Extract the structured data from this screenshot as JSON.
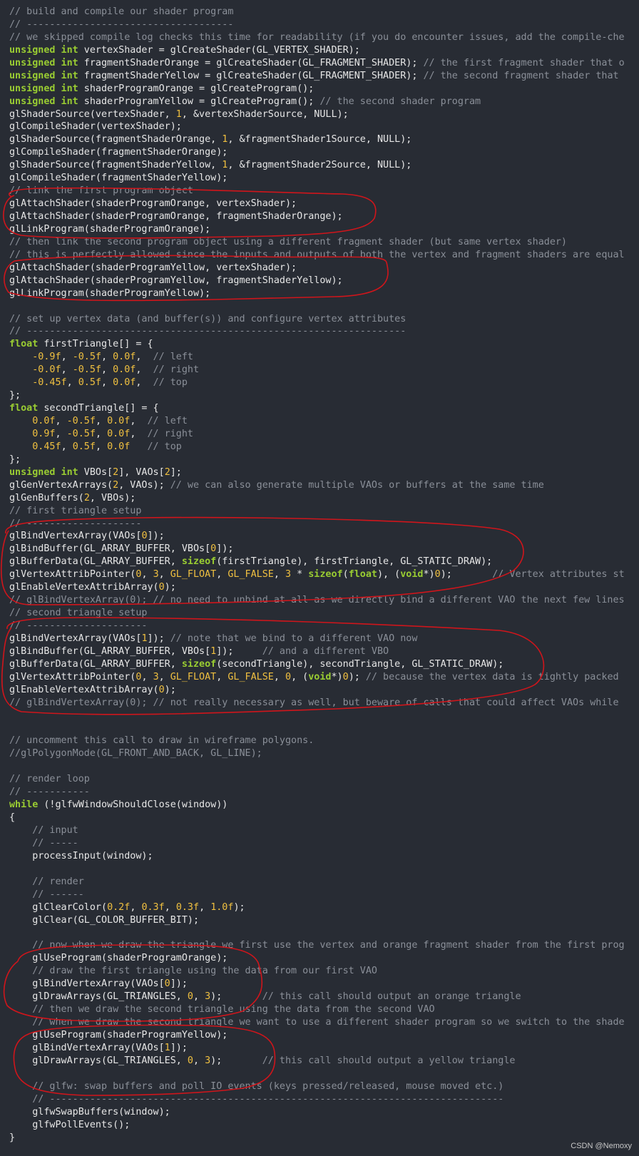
{
  "code_lines": [
    [
      [
        "cm",
        "// build and compile our shader program"
      ]
    ],
    [
      [
        "cm",
        "// ------------------------------------"
      ]
    ],
    [
      [
        "cm",
        "// we skipped compile log checks this time for readability (if you do encounter issues, add the compile-che"
      ]
    ],
    [
      [
        "kw",
        "unsigned int"
      ],
      [
        "pl",
        " vertexShader = glCreateShader(GL_VERTEX_SHADER);"
      ]
    ],
    [
      [
        "kw",
        "unsigned int"
      ],
      [
        "pl",
        " fragmentShaderOrange = glCreateShader(GL_FRAGMENT_SHADER); "
      ],
      [
        "cm",
        "// the first fragment shader that o"
      ]
    ],
    [
      [
        "kw",
        "unsigned int"
      ],
      [
        "pl",
        " fragmentShaderYellow = glCreateShader(GL_FRAGMENT_SHADER); "
      ],
      [
        "cm",
        "// the second fragment shader that"
      ]
    ],
    [
      [
        "kw",
        "unsigned int"
      ],
      [
        "pl",
        " shaderProgramOrange = glCreateProgram();"
      ]
    ],
    [
      [
        "kw",
        "unsigned int"
      ],
      [
        "pl",
        " shaderProgramYellow = glCreateProgram(); "
      ],
      [
        "cm",
        "// the second shader program"
      ]
    ],
    [
      [
        "pl",
        "glShaderSource(vertexShader, "
      ],
      [
        "num",
        "1"
      ],
      [
        "pl",
        ", &vertexShaderSource, NULL);"
      ]
    ],
    [
      [
        "pl",
        "glCompileShader(vertexShader);"
      ]
    ],
    [
      [
        "pl",
        "glShaderSource(fragmentShaderOrange, "
      ],
      [
        "num",
        "1"
      ],
      [
        "pl",
        ", &fragmentShader1Source, NULL);"
      ]
    ],
    [
      [
        "pl",
        "glCompileShader(fragmentShaderOrange);"
      ]
    ],
    [
      [
        "pl",
        "glShaderSource(fragmentShaderYellow, "
      ],
      [
        "num",
        "1"
      ],
      [
        "pl",
        ", &fragmentShader2Source, NULL);"
      ]
    ],
    [
      [
        "pl",
        "glCompileShader(fragmentShaderYellow);"
      ]
    ],
    [
      [
        "cm",
        "// link the first program object"
      ]
    ],
    [
      [
        "pl",
        "glAttachShader(shaderProgramOrange, vertexShader);"
      ]
    ],
    [
      [
        "pl",
        "glAttachShader(shaderProgramOrange, fragmentShaderOrange);"
      ]
    ],
    [
      [
        "pl",
        "glLinkProgram(shaderProgramOrange);"
      ]
    ],
    [
      [
        "cm",
        "// then link the second program object using a different fragment shader (but same vertex shader)"
      ]
    ],
    [
      [
        "cm",
        "// this is perfectly allowed since the inputs and outputs of both the vertex and fragment shaders are equal"
      ]
    ],
    [
      [
        "pl",
        "glAttachShader(shaderProgramYellow, vertexShader);"
      ]
    ],
    [
      [
        "pl",
        "glAttachShader(shaderProgramYellow, fragmentShaderYellow);"
      ]
    ],
    [
      [
        "pl",
        "glLinkProgram(shaderProgramYellow);"
      ]
    ],
    [],
    [
      [
        "cm",
        "// set up vertex data (and buffer(s)) and configure vertex attributes"
      ]
    ],
    [
      [
        "cm",
        "// ------------------------------------------------------------------"
      ]
    ],
    [
      [
        "kw",
        "float"
      ],
      [
        "pl",
        " firstTriangle[] = {"
      ]
    ],
    [
      [
        "pl",
        "    "
      ],
      [
        "num",
        "-0.9f"
      ],
      [
        "pl",
        ", "
      ],
      [
        "num",
        "-0.5f"
      ],
      [
        "pl",
        ", "
      ],
      [
        "num",
        "0.0f"
      ],
      [
        "pl",
        ",  "
      ],
      [
        "cm",
        "// left"
      ]
    ],
    [
      [
        "pl",
        "    "
      ],
      [
        "num",
        "-0.0f"
      ],
      [
        "pl",
        ", "
      ],
      [
        "num",
        "-0.5f"
      ],
      [
        "pl",
        ", "
      ],
      [
        "num",
        "0.0f"
      ],
      [
        "pl",
        ",  "
      ],
      [
        "cm",
        "// right"
      ]
    ],
    [
      [
        "pl",
        "    "
      ],
      [
        "num",
        "-0.45f"
      ],
      [
        "pl",
        ", "
      ],
      [
        "num",
        "0.5f"
      ],
      [
        "pl",
        ", "
      ],
      [
        "num",
        "0.0f"
      ],
      [
        "pl",
        ",  "
      ],
      [
        "cm",
        "// top"
      ]
    ],
    [
      [
        "pl",
        "};"
      ]
    ],
    [
      [
        "kw",
        "float"
      ],
      [
        "pl",
        " secondTriangle[] = {"
      ]
    ],
    [
      [
        "pl",
        "    "
      ],
      [
        "num",
        "0.0f"
      ],
      [
        "pl",
        ", "
      ],
      [
        "num",
        "-0.5f"
      ],
      [
        "pl",
        ", "
      ],
      [
        "num",
        "0.0f"
      ],
      [
        "pl",
        ",  "
      ],
      [
        "cm",
        "// left"
      ]
    ],
    [
      [
        "pl",
        "    "
      ],
      [
        "num",
        "0.9f"
      ],
      [
        "pl",
        ", "
      ],
      [
        "num",
        "-0.5f"
      ],
      [
        "pl",
        ", "
      ],
      [
        "num",
        "0.0f"
      ],
      [
        "pl",
        ",  "
      ],
      [
        "cm",
        "// right"
      ]
    ],
    [
      [
        "pl",
        "    "
      ],
      [
        "num",
        "0.45f"
      ],
      [
        "pl",
        ", "
      ],
      [
        "num",
        "0.5f"
      ],
      [
        "pl",
        ", "
      ],
      [
        "num",
        "0.0f"
      ],
      [
        "pl",
        "   "
      ],
      [
        "cm",
        "// top"
      ]
    ],
    [
      [
        "pl",
        "};"
      ]
    ],
    [
      [
        "kw",
        "unsigned int"
      ],
      [
        "pl",
        " VBOs["
      ],
      [
        "num",
        "2"
      ],
      [
        "pl",
        "], VAOs["
      ],
      [
        "num",
        "2"
      ],
      [
        "pl",
        "];"
      ]
    ],
    [
      [
        "pl",
        "glGenVertexArrays("
      ],
      [
        "num",
        "2"
      ],
      [
        "pl",
        ", VAOs); "
      ],
      [
        "cm",
        "// we can also generate multiple VAOs or buffers at the same time"
      ]
    ],
    [
      [
        "pl",
        "glGenBuffers("
      ],
      [
        "num",
        "2"
      ],
      [
        "pl",
        ", VBOs);"
      ]
    ],
    [
      [
        "cm",
        "// first triangle setup"
      ]
    ],
    [
      [
        "cm",
        "// --------------------"
      ]
    ],
    [
      [
        "pl",
        "glBindVertexArray(VAOs["
      ],
      [
        "num",
        "0"
      ],
      [
        "pl",
        "]);"
      ]
    ],
    [
      [
        "pl",
        "glBindBuffer(GL_ARRAY_BUFFER, VBOs["
      ],
      [
        "num",
        "0"
      ],
      [
        "pl",
        "]);"
      ]
    ],
    [
      [
        "pl",
        "glBufferData(GL_ARRAY_BUFFER, "
      ],
      [
        "kw",
        "sizeof"
      ],
      [
        "pl",
        "(firstTriangle), firstTriangle, GL_STATIC_DRAW);"
      ]
    ],
    [
      [
        "pl",
        "glVertexAttribPointer("
      ],
      [
        "num",
        "0"
      ],
      [
        "pl",
        ", "
      ],
      [
        "num",
        "3"
      ],
      [
        "pl",
        ", "
      ],
      [
        "num",
        "GL_FLOAT"
      ],
      [
        "pl",
        ", "
      ],
      [
        "num",
        "GL_FALSE"
      ],
      [
        "pl",
        ", "
      ],
      [
        "num",
        "3"
      ],
      [
        "pl",
        " * "
      ],
      [
        "kw",
        "sizeof"
      ],
      [
        "pl",
        "("
      ],
      [
        "kw",
        "float"
      ],
      [
        "pl",
        "), ("
      ],
      [
        "kw",
        "void"
      ],
      [
        "pl",
        "*)"
      ],
      [
        "num",
        "0"
      ],
      [
        "pl",
        ");       "
      ],
      [
        "cm",
        "// Vertex attributes st"
      ]
    ],
    [
      [
        "pl",
        "glEnableVertexAttribArray("
      ],
      [
        "num",
        "0"
      ],
      [
        "pl",
        ");"
      ]
    ],
    [
      [
        "cm",
        "// glBindVertexArray(0); // no need to unbind at all as we directly bind a different VAO the next few lines"
      ]
    ],
    [
      [
        "cm",
        "// second triangle setup"
      ]
    ],
    [
      [
        "cm",
        "// ---------------------"
      ]
    ],
    [
      [
        "pl",
        "glBindVertexArray(VAOs["
      ],
      [
        "num",
        "1"
      ],
      [
        "pl",
        "]); "
      ],
      [
        "cm",
        "// note that we bind to a different VAO now"
      ]
    ],
    [
      [
        "pl",
        "glBindBuffer(GL_ARRAY_BUFFER, VBOs["
      ],
      [
        "num",
        "1"
      ],
      [
        "pl",
        "]);     "
      ],
      [
        "cm",
        "// and a different VBO"
      ]
    ],
    [
      [
        "pl",
        "glBufferData(GL_ARRAY_BUFFER, "
      ],
      [
        "kw",
        "sizeof"
      ],
      [
        "pl",
        "(secondTriangle), secondTriangle, GL_STATIC_DRAW);"
      ]
    ],
    [
      [
        "pl",
        "glVertexAttribPointer("
      ],
      [
        "num",
        "0"
      ],
      [
        "pl",
        ", "
      ],
      [
        "num",
        "3"
      ],
      [
        "pl",
        ", "
      ],
      [
        "num",
        "GL_FLOAT"
      ],
      [
        "pl",
        ", "
      ],
      [
        "num",
        "GL_FALSE"
      ],
      [
        "pl",
        ", "
      ],
      [
        "num",
        "0"
      ],
      [
        "pl",
        ", ("
      ],
      [
        "kw",
        "void"
      ],
      [
        "pl",
        "*)"
      ],
      [
        "num",
        "0"
      ],
      [
        "pl",
        "); "
      ],
      [
        "cm",
        "// because the vertex data is tightly packed"
      ]
    ],
    [
      [
        "pl",
        "glEnableVertexAttribArray("
      ],
      [
        "num",
        "0"
      ],
      [
        "pl",
        ");"
      ]
    ],
    [
      [
        "cm",
        "// glBindVertexArray(0); // not really necessary as well, but beware of calls that could affect VAOs while"
      ]
    ],
    [],
    [],
    [
      [
        "cm",
        "// uncomment this call to draw in wireframe polygons."
      ]
    ],
    [
      [
        "cm",
        "//glPolygonMode(GL_FRONT_AND_BACK, GL_LINE);"
      ]
    ],
    [],
    [
      [
        "cm",
        "// render loop"
      ]
    ],
    [
      [
        "cm",
        "// -----------"
      ]
    ],
    [
      [
        "kw",
        "while"
      ],
      [
        "pl",
        " (!glfwWindowShouldClose(window))"
      ]
    ],
    [
      [
        "pl",
        "{"
      ]
    ],
    [
      [
        "pl",
        "    "
      ],
      [
        "cm",
        "// input"
      ]
    ],
    [
      [
        "pl",
        "    "
      ],
      [
        "cm",
        "// -----"
      ]
    ],
    [
      [
        "pl",
        "    processInput(window);"
      ]
    ],
    [],
    [
      [
        "pl",
        "    "
      ],
      [
        "cm",
        "// render"
      ]
    ],
    [
      [
        "pl",
        "    "
      ],
      [
        "cm",
        "// ------"
      ]
    ],
    [
      [
        "pl",
        "    glClearColor("
      ],
      [
        "num",
        "0.2f"
      ],
      [
        "pl",
        ", "
      ],
      [
        "num",
        "0.3f"
      ],
      [
        "pl",
        ", "
      ],
      [
        "num",
        "0.3f"
      ],
      [
        "pl",
        ", "
      ],
      [
        "num",
        "1.0f"
      ],
      [
        "pl",
        ");"
      ]
    ],
    [
      [
        "pl",
        "    glClear(GL_COLOR_BUFFER_BIT);"
      ]
    ],
    [],
    [
      [
        "pl",
        "    "
      ],
      [
        "cm",
        "// now when we draw the triangle we first use the vertex and orange fragment shader from the first prog"
      ]
    ],
    [
      [
        "pl",
        "    glUseProgram(shaderProgramOrange);"
      ]
    ],
    [
      [
        "pl",
        "    "
      ],
      [
        "cm",
        "// draw the first triangle using the data from our first VAO"
      ]
    ],
    [
      [
        "pl",
        "    glBindVertexArray(VAOs["
      ],
      [
        "num",
        "0"
      ],
      [
        "pl",
        "]);"
      ]
    ],
    [
      [
        "pl",
        "    glDrawArrays(GL_TRIANGLES, "
      ],
      [
        "num",
        "0"
      ],
      [
        "pl",
        ", "
      ],
      [
        "num",
        "3"
      ],
      [
        "pl",
        ");       "
      ],
      [
        "cm",
        "// this call should output an orange triangle"
      ]
    ],
    [
      [
        "pl",
        "    "
      ],
      [
        "cm",
        "// then we draw the second triangle using the data from the second VAO"
      ]
    ],
    [
      [
        "pl",
        "    "
      ],
      [
        "cm",
        "// when we draw the second triangle we want to use a different shader program so we switch to the shade"
      ]
    ],
    [
      [
        "pl",
        "    glUseProgram(shaderProgramYellow);"
      ]
    ],
    [
      [
        "pl",
        "    glBindVertexArray(VAOs["
      ],
      [
        "num",
        "1"
      ],
      [
        "pl",
        "]);"
      ]
    ],
    [
      [
        "pl",
        "    glDrawArrays(GL_TRIANGLES, "
      ],
      [
        "num",
        "0"
      ],
      [
        "pl",
        ", "
      ],
      [
        "num",
        "3"
      ],
      [
        "pl",
        ");       "
      ],
      [
        "cm",
        "// this call should output a yellow triangle"
      ]
    ],
    [],
    [
      [
        "pl",
        "    "
      ],
      [
        "cm",
        "// glfw: swap buffers and poll IO events (keys pressed/released, mouse moved etc.)"
      ]
    ],
    [
      [
        "pl",
        "    "
      ],
      [
        "cm",
        "// -------------------------------------------------------------------------------"
      ]
    ],
    [
      [
        "pl",
        "    glfwSwapBuffers(window);"
      ]
    ],
    [
      [
        "pl",
        "    glfwPollEvents();"
      ]
    ],
    [
      [
        "pl",
        "}"
      ]
    ]
  ],
  "watermark": "CSDN @Nemoxy",
  "colors": {
    "background": "#282c34",
    "comment": "#8a8f98",
    "keyword": "#9acd32",
    "number": "#f0c040",
    "plain": "#e6e6e6",
    "annotation": "#d0151b"
  }
}
